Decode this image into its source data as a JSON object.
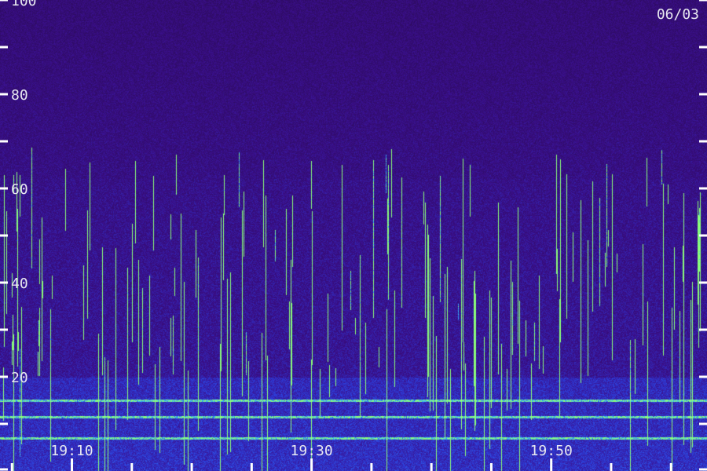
{
  "chart_data": {
    "type": "heatmap",
    "title": "",
    "xlabel": "",
    "ylabel": "",
    "date_label": "06/03",
    "colors": {
      "background": "#2a0a55",
      "low": "#3a0f8a",
      "mid": "#2d3bd8",
      "high": "#39b7ff",
      "peak": "#8cff7a",
      "text": "#e8e8f0",
      "ticks": "#ffffff"
    },
    "y_axis": {
      "ylim": [
        0,
        100
      ],
      "tick_labels": [
        "100",
        "80",
        "60",
        "40",
        "20"
      ],
      "tick_values": [
        100,
        80,
        60,
        40,
        20
      ],
      "minor_tick_values": [
        90,
        70,
        50,
        30,
        10,
        0
      ]
    },
    "x_axis": {
      "tick_labels": [
        "19:10",
        "19:30",
        "19:50"
      ],
      "tick_values_minutes": [
        1150,
        1170,
        1190
      ],
      "xlim_minutes": [
        1144,
        1203
      ],
      "minor_tick_interval_minutes": 5
    },
    "intensity_profile": {
      "noise_floor_band": [
        0,
        20
      ],
      "strong_activity_band": [
        0,
        62
      ],
      "weak_activity_band": [
        62,
        100
      ]
    }
  }
}
